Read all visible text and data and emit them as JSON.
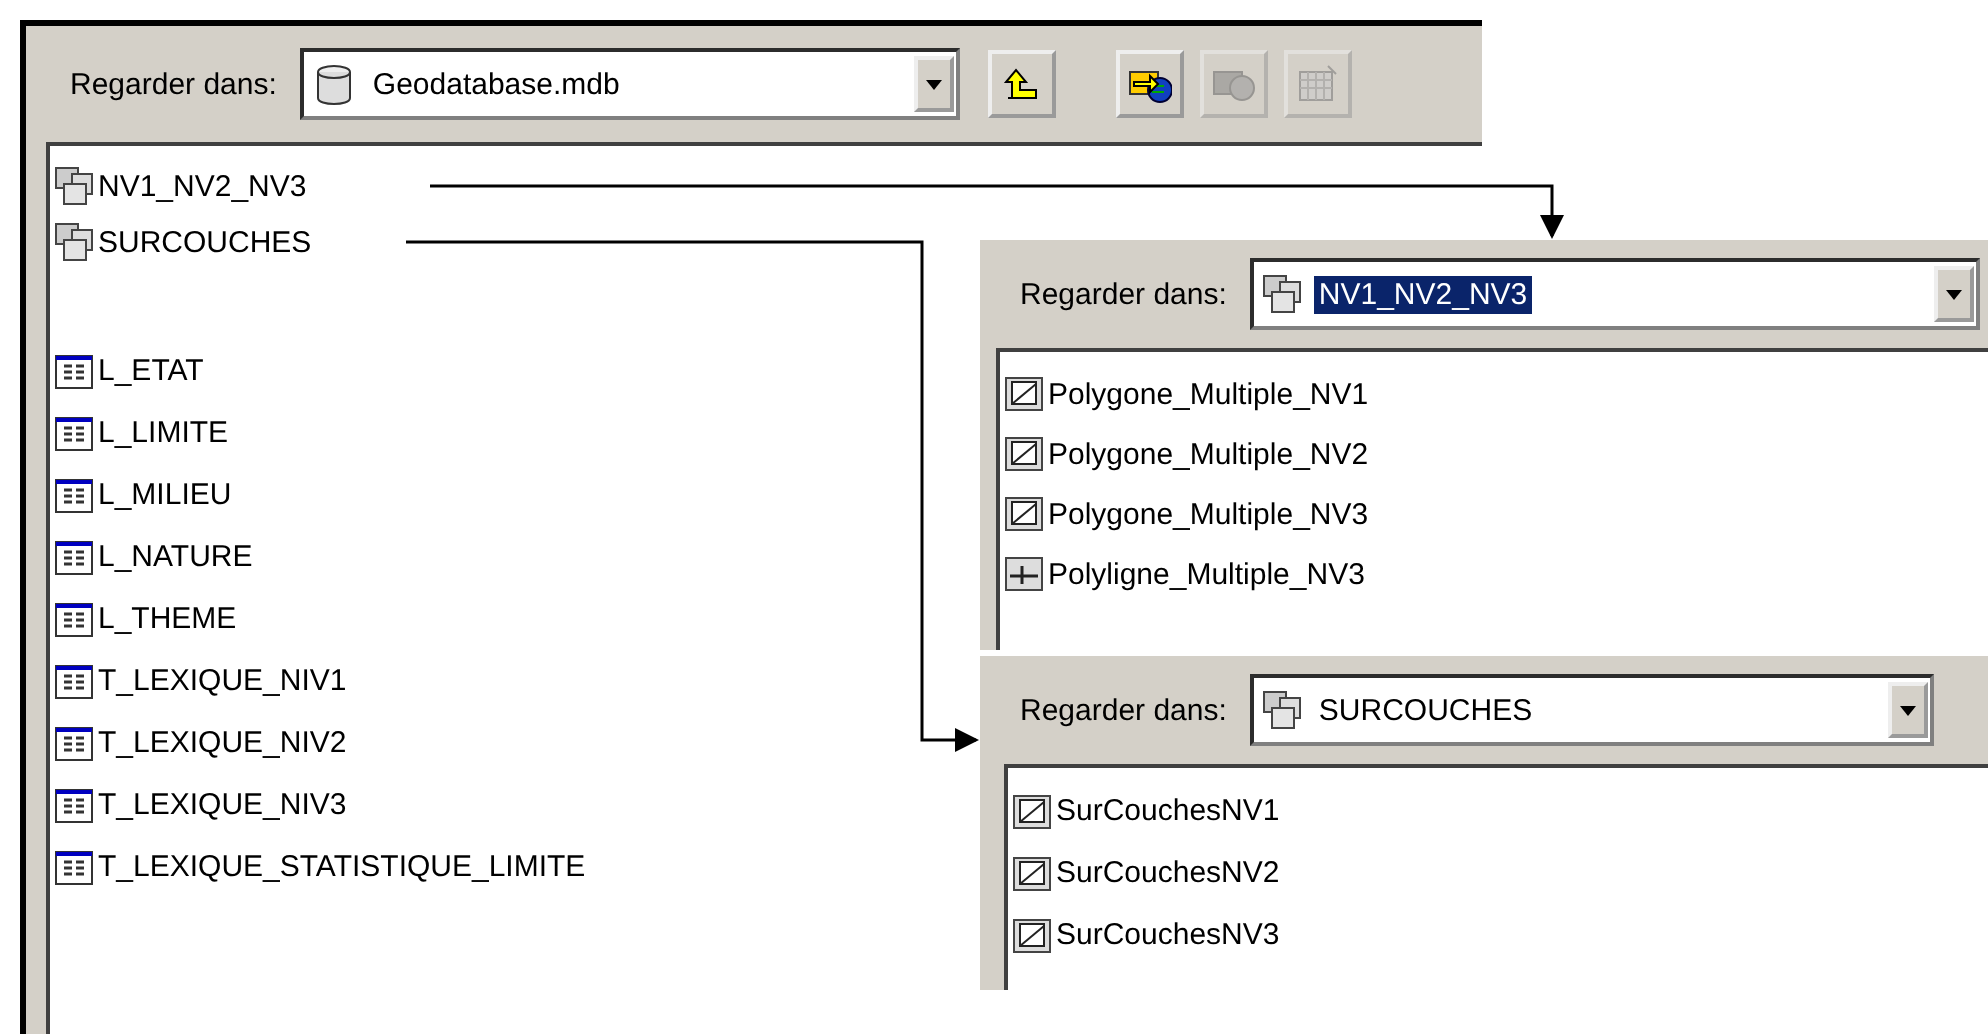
{
  "main": {
    "look_in": {
      "label": "Regarder dans:",
      "value": "Geodatabase.mdb",
      "kind": "database",
      "selected": false
    },
    "toolbar": [
      {
        "kind": "up",
        "disabled": false
      },
      {
        "kind": "connect",
        "disabled": false
      },
      {
        "kind": "disconnect",
        "disabled": true
      },
      {
        "kind": "new",
        "disabled": true
      }
    ],
    "items": [
      {
        "label": "NV1_NV2_NV3",
        "kind": "dataset"
      },
      {
        "label": "SURCOUCHES",
        "kind": "dataset"
      },
      {
        "label": "L_ETAT",
        "kind": "table"
      },
      {
        "label": "L_LIMITE",
        "kind": "table"
      },
      {
        "label": "L_MILIEU",
        "kind": "table"
      },
      {
        "label": "L_NATURE",
        "kind": "table"
      },
      {
        "label": "L_THEME",
        "kind": "table"
      },
      {
        "label": "T_LEXIQUE_NIV1",
        "kind": "table"
      },
      {
        "label": "T_LEXIQUE_NIV2",
        "kind": "table"
      },
      {
        "label": "T_LEXIQUE_NIV3",
        "kind": "table"
      },
      {
        "label": "T_LEXIQUE_STATISTIQUE_LIMITE",
        "kind": "table"
      }
    ]
  },
  "panels": [
    {
      "look_in": {
        "label": "Regarder dans:",
        "value": "NV1_NV2_NV3",
        "kind": "dataset",
        "selected": true
      },
      "items": [
        {
          "label": "Polygone_Multiple_NV1",
          "kind": "polygon"
        },
        {
          "label": "Polygone_Multiple_NV2",
          "kind": "polygon"
        },
        {
          "label": "Polygone_Multiple_NV3",
          "kind": "polygon"
        },
        {
          "label": "Polyligne_Multiple_NV3",
          "kind": "polyline"
        }
      ]
    },
    {
      "look_in": {
        "label": "Regarder dans:",
        "value": "SURCOUCHES",
        "kind": "dataset",
        "selected": false
      },
      "items": [
        {
          "label": "SurCouchesNV1",
          "kind": "polygon"
        },
        {
          "label": "SurCouchesNV2",
          "kind": "polygon"
        },
        {
          "label": "SurCouchesNV3",
          "kind": "polygon"
        }
      ]
    }
  ]
}
